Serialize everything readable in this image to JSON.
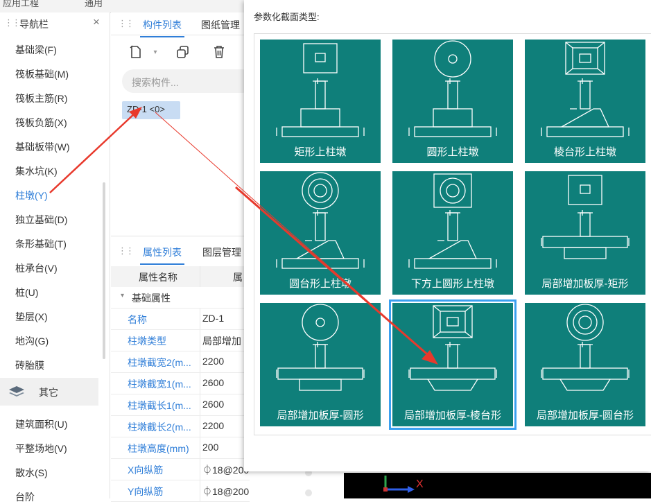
{
  "topbar": {
    "tab_a": "应用工程",
    "tab_b": "通用"
  },
  "nav": {
    "title": "导航栏",
    "close_label": "×",
    "items": [
      {
        "label": "基础梁(F)"
      },
      {
        "label": "筏板基础(M)"
      },
      {
        "label": "筏板主筋(R)"
      },
      {
        "label": "筏板负筋(X)"
      },
      {
        "label": "基础板带(W)"
      },
      {
        "label": "集水坑(K)"
      },
      {
        "label": "柱墩(Y)",
        "active": true
      },
      {
        "label": "独立基础(D)"
      },
      {
        "label": "条形基础(T)"
      },
      {
        "label": "桩承台(V)"
      },
      {
        "label": "桩(U)"
      },
      {
        "label": "垫层(X)"
      },
      {
        "label": "地沟(G)"
      },
      {
        "label": "砖胎膜"
      }
    ],
    "group_other": "其它",
    "other_items": [
      {
        "label": "建筑面积(U)"
      },
      {
        "label": "平整场地(V)"
      },
      {
        "label": "散水(S)"
      },
      {
        "label": "台阶"
      }
    ]
  },
  "component_panel": {
    "tab_active": "构件列表",
    "tab_other": "图纸管理",
    "search_placeholder": "搜索构件...",
    "selected_item": "ZD-1 <0>"
  },
  "property_panel": {
    "tab_active": "属性列表",
    "tab_other": "图层管理",
    "col_name": "属性名称",
    "col_value": "属",
    "group": "基础属性",
    "rows": [
      {
        "name": "名称",
        "value": "ZD-1"
      },
      {
        "name": "柱墩类型",
        "value": "局部增加"
      },
      {
        "name": "柱墩截宽2(m...",
        "value": "2200"
      },
      {
        "name": "柱墩截宽1(m...",
        "value": "2600"
      },
      {
        "name": "柱墩截长1(m...",
        "value": "2600"
      },
      {
        "name": "柱墩截长2(m...",
        "value": "2200"
      },
      {
        "name": "柱墩高度(mm)",
        "value": "200"
      },
      {
        "name": "X向纵筋",
        "value": "⏀18@200"
      },
      {
        "name": "Y向纵筋",
        "value": "⏀18@200"
      }
    ]
  },
  "dialog": {
    "title": "参数化截面类型:",
    "options": [
      {
        "label": "矩形上柱墩",
        "top": "square",
        "shape": "rect"
      },
      {
        "label": "圆形上柱墩",
        "top": "circle",
        "shape": "rect"
      },
      {
        "label": "棱台形上柱墩",
        "top": "frustum",
        "shape": "trap-up"
      },
      {
        "label": "圆台形上柱墩",
        "top": "double-circle",
        "shape": "trap-up"
      },
      {
        "label": "下方上圆形上柱墩",
        "top": "circle-in-square",
        "shape": "trap-up"
      },
      {
        "label": "局部增加板厚-矩形",
        "top": "square",
        "shape": "rect-down"
      },
      {
        "label": "局部增加板厚-圆形",
        "top": "circle",
        "shape": "rect-down"
      },
      {
        "label": "局部增加板厚-棱台形",
        "top": "frustum",
        "shape": "trap-down",
        "selected": true
      },
      {
        "label": "局部增加板厚-圆台形",
        "top": "double-circle",
        "shape": "trap-down"
      }
    ]
  },
  "viewport": {
    "axis_x_label": "X"
  },
  "colors": {
    "card_bg": "#0f7f7a",
    "accent": "#2f7ed8",
    "selection": "#3aa0f0",
    "arrow": "#e8392c"
  }
}
